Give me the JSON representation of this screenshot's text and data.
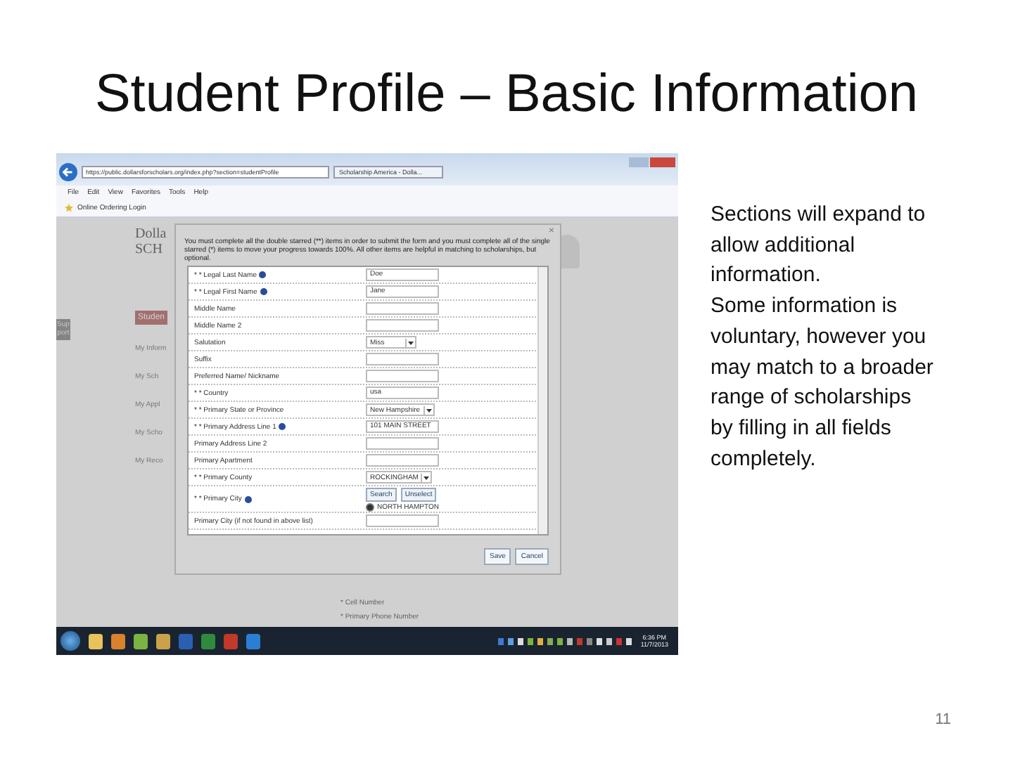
{
  "slide": {
    "title": "Student Profile – Basic Information",
    "paragraphs": [
      "Sections will expand to allow additional information.",
      "Some information is voluntary, however you may match to a broader range of scholarships by filling in all fields completely."
    ],
    "page_number": "11"
  },
  "browser": {
    "url": "https://public.dollarsforscholars.org/index.php?section=studentProfile",
    "tab": "Scholarship America - Dolla...",
    "menu": [
      "File",
      "Edit",
      "View",
      "Favorites",
      "Tools",
      "Help"
    ],
    "favorites": [
      "Online Ordering Login"
    ]
  },
  "background": {
    "logo": [
      "Dolla",
      "SCH"
    ],
    "support_tab": "Support",
    "heading": "Studen",
    "sidebar": [
      "My Inform",
      "My Sch",
      "My Appl",
      "My Scho",
      "My Reco"
    ],
    "footer_items": [
      "* Cell Number",
      "* Primary Phone Number"
    ]
  },
  "dialog": {
    "close": "×",
    "intro": "You must complete all the double starred (**) items in order to submit the form and you must complete all of the single starred (*) items to move your progress towards 100%. All other items are helpful in matching to scholarships, but optional.",
    "rows": [
      {
        "label": "* * Legal Last Name",
        "help": true,
        "kind": "input",
        "value": "Doe"
      },
      {
        "label": "* * Legal First Name",
        "help": true,
        "kind": "input",
        "value": "Jane"
      },
      {
        "label": "Middle Name",
        "help": false,
        "kind": "input"
      },
      {
        "label": "Middle Name 2",
        "help": false,
        "kind": "input"
      },
      {
        "label": "Salutation",
        "help": false,
        "kind": "select",
        "value": "Miss"
      },
      {
        "label": "Suffix",
        "help": false,
        "kind": "input"
      },
      {
        "label": "Preferred Name/ Nickname",
        "help": false,
        "kind": "input"
      },
      {
        "label": "* * Country",
        "help": false,
        "kind": "input",
        "value": "usa"
      },
      {
        "label": "* * Primary State or Province",
        "help": false,
        "kind": "select",
        "value": "New Hampshire"
      },
      {
        "label": "* * Primary Address Line 1",
        "help": true,
        "kind": "input",
        "value": "101 MAIN STREET"
      },
      {
        "label": "Primary Address Line 2",
        "help": false,
        "kind": "input"
      },
      {
        "label": "Primary Apartment",
        "help": false,
        "kind": "input"
      },
      {
        "label": "* * Primary County",
        "help": false,
        "kind": "select",
        "value": "ROCKINGHAM"
      },
      {
        "label": "* * Primary City",
        "help": true,
        "kind": "lookup",
        "buttons": [
          "Search",
          "Unselect"
        ],
        "option": {
          "label": "NORTH HAMPTON",
          "selected": true
        }
      },
      {
        "label": "Primary City (if not found in above list)",
        "help": false,
        "kind": "input"
      }
    ],
    "buttons": [
      "Save",
      "Cancel"
    ]
  },
  "taskbar": {
    "time": "6:36 PM",
    "date": "11/7/2013"
  }
}
